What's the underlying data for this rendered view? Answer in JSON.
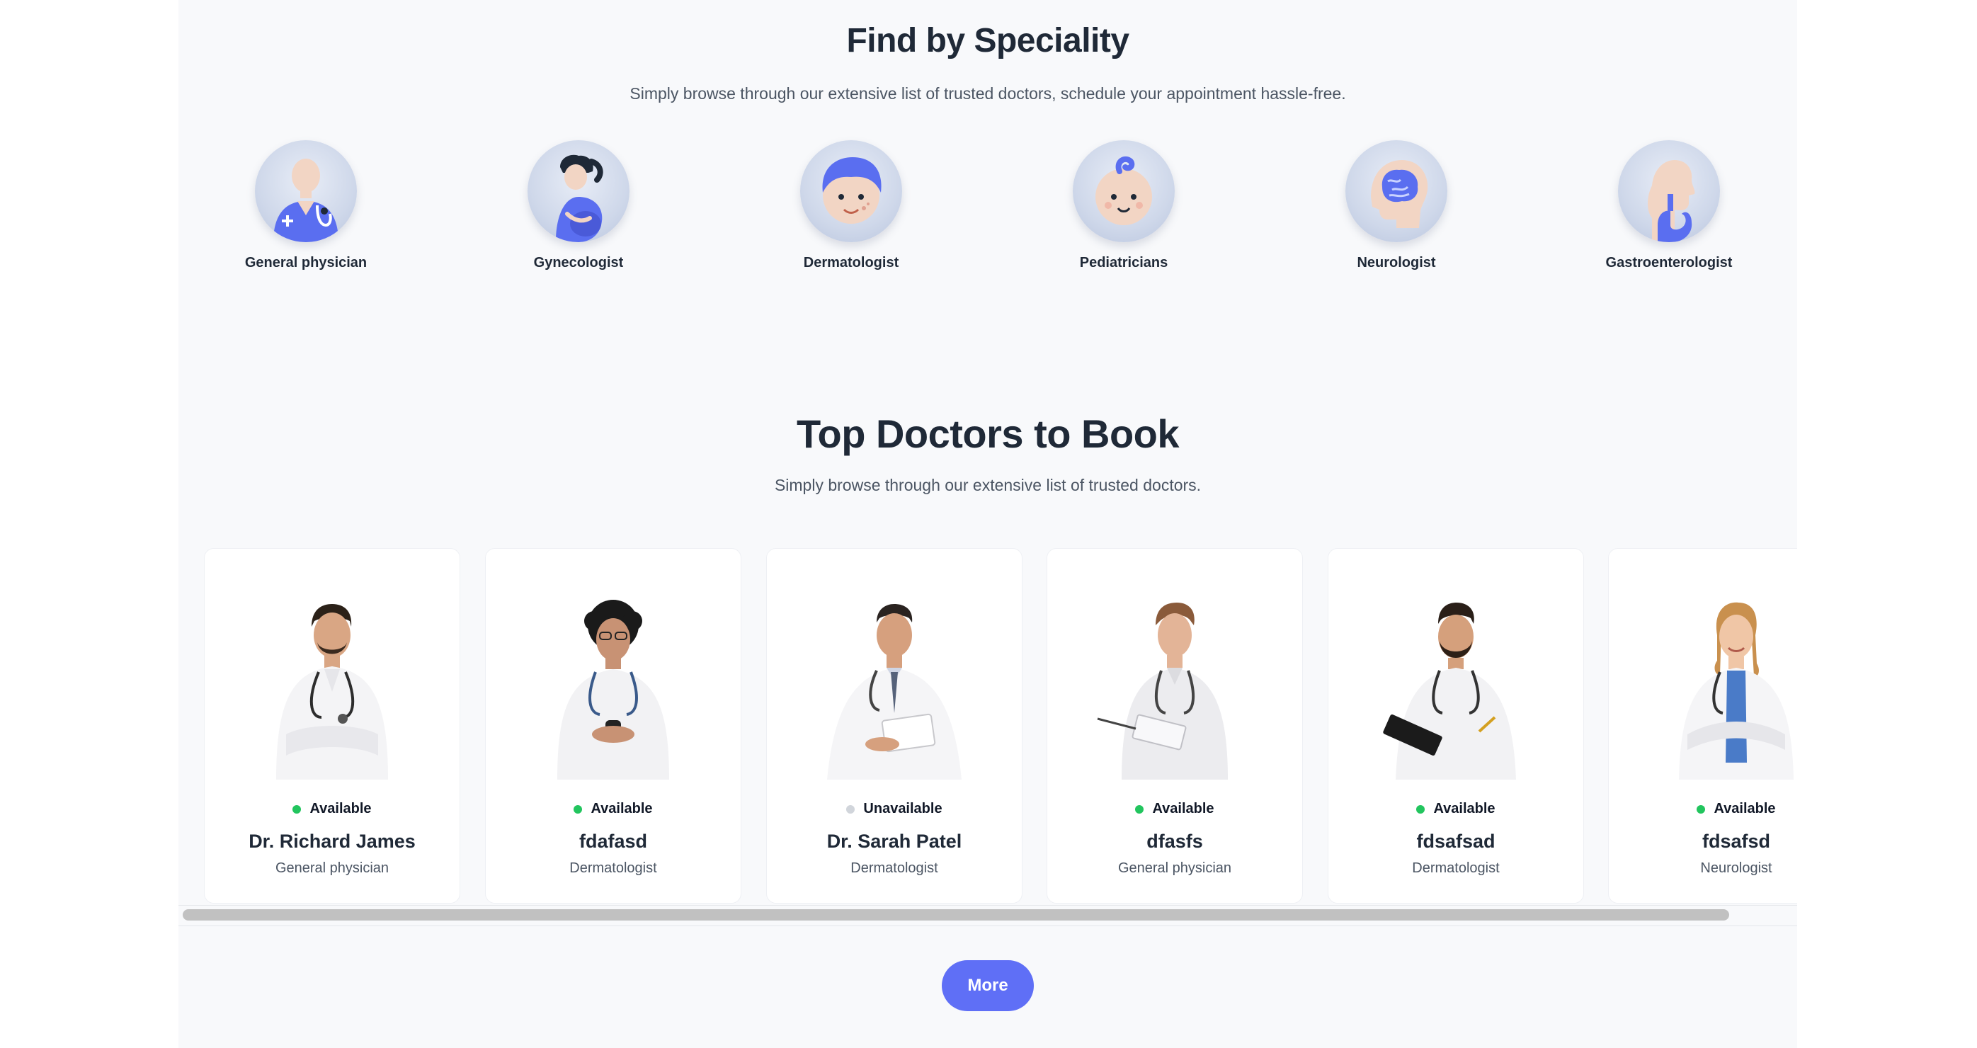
{
  "speciality": {
    "title": "Find by Speciality",
    "subtitle": "Simply browse through our extensive list of trusted doctors, schedule your appointment hassle-free.",
    "items": [
      {
        "label": "General physician",
        "icon": "general-physician-icon"
      },
      {
        "label": "Gynecologist",
        "icon": "gynecologist-icon"
      },
      {
        "label": "Dermatologist",
        "icon": "dermatologist-icon"
      },
      {
        "label": "Pediatricians",
        "icon": "pediatrician-icon"
      },
      {
        "label": "Neurologist",
        "icon": "neurologist-icon"
      },
      {
        "label": "Gastroenterologist",
        "icon": "gastroenterologist-icon"
      }
    ]
  },
  "top_doctors": {
    "title": "Top Doctors to Book",
    "subtitle": "Simply browse through our extensive list of trusted doctors.",
    "doctors": [
      {
        "status": "Available",
        "name": "Dr. Richard James",
        "speciality": "General physician"
      },
      {
        "status": "Available",
        "name": "fdafasd",
        "speciality": "Dermatologist"
      },
      {
        "status": "Unavailable",
        "name": "Dr. Sarah Patel",
        "speciality": "Dermatologist"
      },
      {
        "status": "Available",
        "name": "dfasfs",
        "speciality": "General physician"
      },
      {
        "status": "Available",
        "name": "fdsafsad",
        "speciality": "Dermatologist"
      },
      {
        "status": "Available",
        "name": "fdsafsd",
        "speciality": "Neurologist"
      }
    ],
    "more_label": "More"
  },
  "colors": {
    "accent": "#5f6ff6",
    "available": "#22c55e",
    "unavailable": "#d1d5db",
    "icon_blue": "#5a6ef0"
  }
}
